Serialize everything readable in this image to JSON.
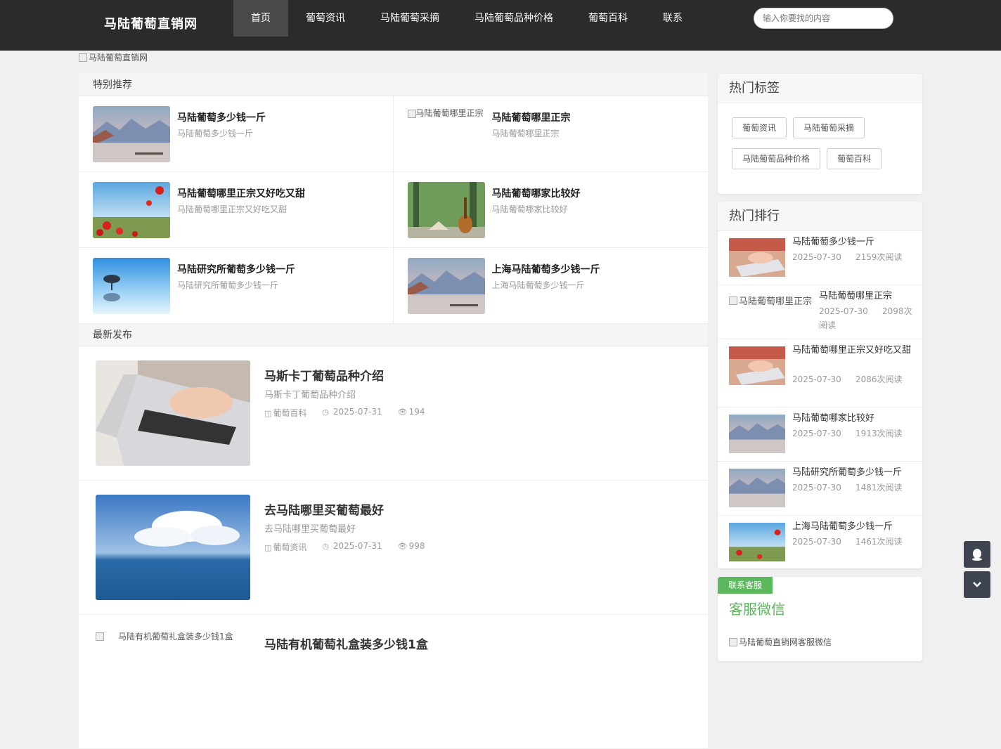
{
  "header": {
    "logo": "马陆葡萄直销网",
    "nav": [
      "首页",
      "葡萄资讯",
      "马陆葡萄采摘",
      "马陆葡萄品种价格",
      "葡萄百科",
      "联系"
    ],
    "search_placeholder": "输入你要找的内容"
  },
  "banner_alt": "马陆葡萄直销网",
  "featured": {
    "heading": "特别推荐",
    "items": [
      {
        "title": "马陆葡萄多少钱一斤",
        "sub": "马陆葡萄多少钱一斤",
        "img": "lake"
      },
      {
        "title": "马陆葡萄哪里正宗",
        "sub": "马陆葡萄哪里正宗",
        "img_alt": "马陆葡萄哪里正宗"
      },
      {
        "title": "马陆葡萄哪里正宗又好吃又甜",
        "sub": "马陆葡萄哪里正宗又好吃又甜",
        "img": "poppies"
      },
      {
        "title": "马陆葡萄哪家比较好",
        "sub": "马陆葡萄哪家比较好",
        "img": "guitar"
      },
      {
        "title": "马陆研究所葡萄多少钱一斤",
        "sub": "马陆研究所葡萄多少钱一斤",
        "img": "tree"
      },
      {
        "title": "上海马陆葡萄多少钱一斤",
        "sub": "上海马陆葡萄多少钱一斤",
        "img": "lake"
      }
    ]
  },
  "latest": {
    "heading": "最新发布",
    "posts": [
      {
        "title": "马斯卡丁葡萄品种介绍",
        "sub": "马斯卡丁葡萄品种介绍",
        "category": "葡萄百科",
        "date": "2025-07-31",
        "views": "194"
      },
      {
        "title": "去马陆哪里买葡萄最好",
        "sub": "去马陆哪里买葡萄最好",
        "category": "葡萄资讯",
        "date": "2025-07-31",
        "views": "998"
      },
      {
        "title": "马陆有机葡萄礼盒装多少钱1盒",
        "img_alt": "马陆有机葡萄礼盒装多少钱1盒"
      }
    ]
  },
  "hot_tags": {
    "heading": "热门标签",
    "tags": [
      "葡萄资讯",
      "马陆葡萄采摘",
      "马陆葡萄品种价格",
      "葡萄百科"
    ]
  },
  "hot_rank": {
    "heading": "热门排行",
    "items": [
      {
        "title": "马陆葡萄多少钱一斤",
        "date": "2025-07-30",
        "views": "2159次阅读"
      },
      {
        "title": "马陆葡萄哪里正宗",
        "date": "2025-07-30",
        "views": "2098次阅读",
        "img_alt": "马陆葡萄哪里正宗"
      },
      {
        "title": "马陆葡萄哪里正宗又好吃又甜",
        "date": "2025-07-30",
        "views": "2086次阅读"
      },
      {
        "title": "马陆葡萄哪家比较好",
        "date": "2025-07-30",
        "views": "1913次阅读"
      },
      {
        "title": "马陆研究所葡萄多少钱一斤",
        "date": "2025-07-30",
        "views": "1481次阅读"
      },
      {
        "title": "上海马陆葡萄多少钱一斤",
        "date": "2025-07-30",
        "views": "1461次阅读"
      }
    ]
  },
  "service": {
    "badge": "联系客服",
    "title": "客服微信",
    "img_alt": "马陆葡萄直销网客服微信"
  },
  "colors": {
    "topbar": "#2b2b2b",
    "accent_green": "#5cb85c",
    "float_button": "#3d4450"
  }
}
